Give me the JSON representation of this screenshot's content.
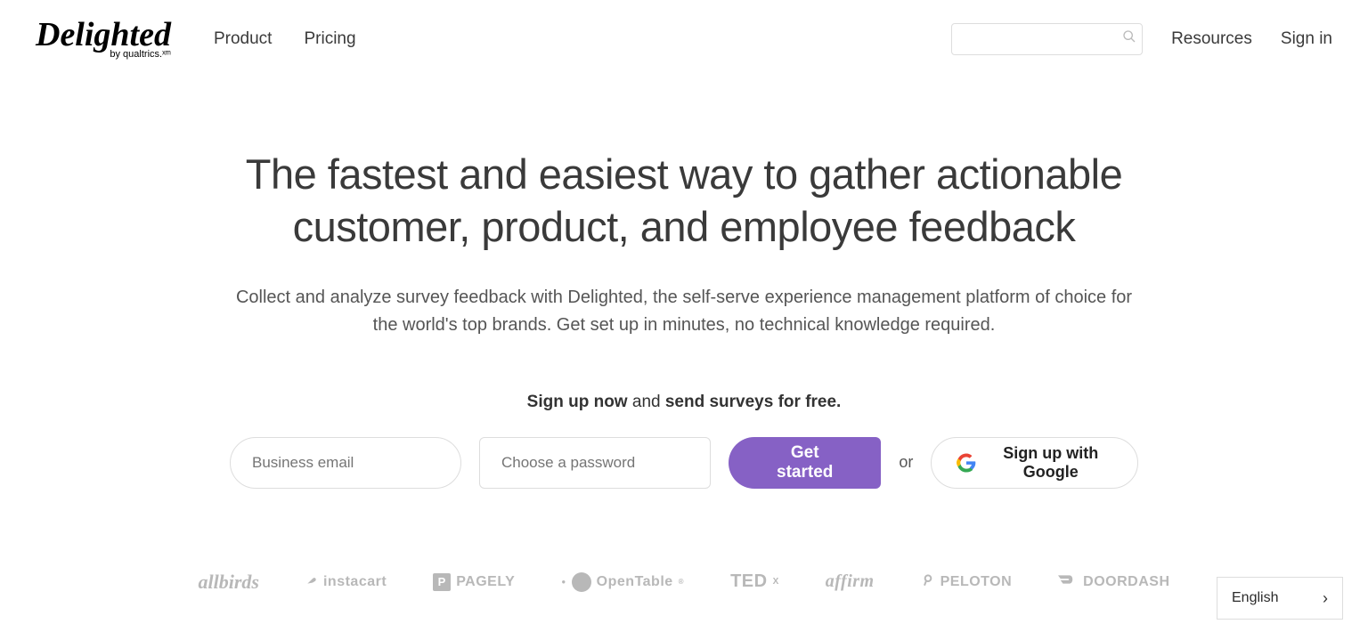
{
  "logo": {
    "main": "Delighted",
    "sub": "by qualtrics.ˣᵐ"
  },
  "nav": {
    "product": "Product",
    "pricing": "Pricing",
    "resources": "Resources",
    "signin": "Sign in"
  },
  "search": {
    "placeholder": ""
  },
  "hero": {
    "title": "The fastest and easiest way to gather actionable customer, product, and employee feedback",
    "subtitle": "Collect and analyze survey feedback with Delighted, the self-serve experience management platform of choice for the world's top brands. Get set up in minutes, no technical knowledge required."
  },
  "signup": {
    "cta_bold1": "Sign up now",
    "cta_mid": " and ",
    "cta_bold2": "send surveys for free.",
    "email_placeholder": "Business email",
    "password_placeholder": "Choose a password",
    "button": "Get started",
    "or": "or",
    "google": "Sign up with Google"
  },
  "brands": {
    "allbirds": "allbirds",
    "instacart": "instacart",
    "pagely": "PAGELY",
    "opentable": "OpenTable",
    "tedx_pre": "TED",
    "tedx_suf": "X",
    "affirm": "affirm",
    "peloton": "PELOTON",
    "doordash": "DOORDASH"
  },
  "lang": {
    "label": "English"
  }
}
